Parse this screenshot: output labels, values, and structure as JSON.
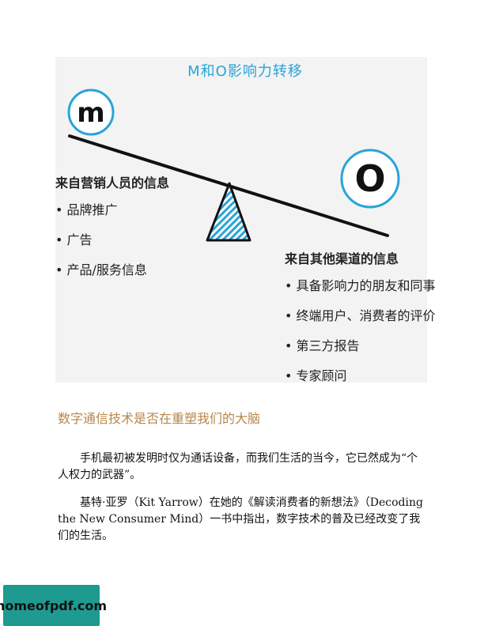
{
  "figure": {
    "title": "M和O影响力转移",
    "m_letter": "m",
    "o_letter": "O",
    "left_heading": "来自营销人员的信息",
    "left_items": [
      "品牌推广",
      "广告",
      "产品/服务信息"
    ],
    "right_heading": "来自其他渠道的信息",
    "right_items": [
      "具备影响力的朋友和同事",
      "终端用户、消费者的评价",
      "第三方报告",
      "专家顾问"
    ],
    "accent_color": "#2aa3d8"
  },
  "section_heading": "数字通信技术是否在重塑我们的大脑",
  "paragraphs": [
    "手机最初被发明时仅为通话设备，而我们生活的当今，它已然成为“个人权力的武器”。",
    "基特·亚罗（Kit Yarrow）在她的《解读消费者的新想法》（Decoding the New Consumer Mind）一书中指出，数字技术的普及已经改变了我们的生活。"
  ],
  "watermark": "homeofpdf.com"
}
